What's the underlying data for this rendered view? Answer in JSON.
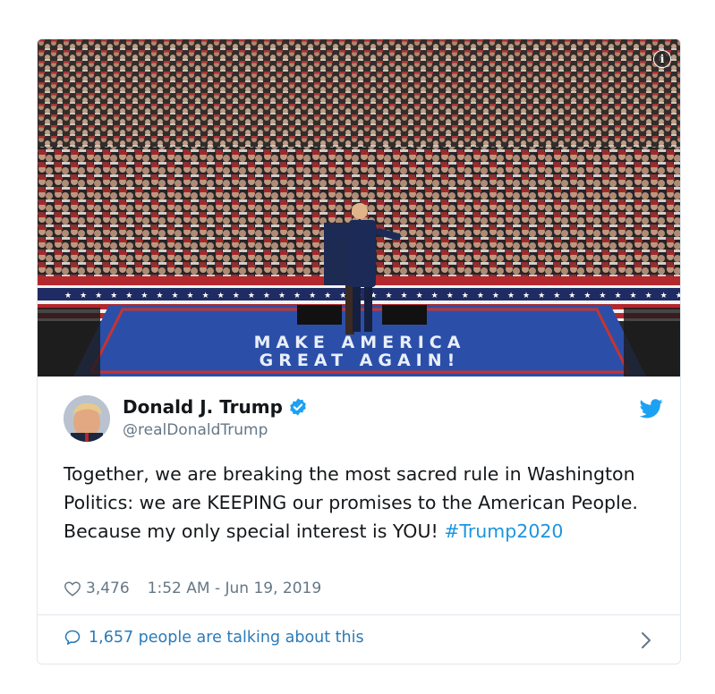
{
  "media": {
    "banner_line1": "MAKE AMERICA",
    "banner_line2": "GREAT AGAIN!",
    "info_icon": "info-icon",
    "info_glyph": "i"
  },
  "author": {
    "display_name": "Donald J. Trump",
    "handle": "@realDonaldTrump",
    "verified": true,
    "brand_color": "#1da1f2"
  },
  "tweet": {
    "text": "Together, we are breaking the most sacred rule in Washington Politics: we are KEEPING our promises to the American People. Because my only special interest is YOU! ",
    "hashtag": "#Trump2020",
    "likes": "3,476",
    "timestamp": "1:52 AM - Jun 19, 2019"
  },
  "footer": {
    "talking_label": "1,657 people are talking about this",
    "link_color": "#2b7bb9"
  }
}
